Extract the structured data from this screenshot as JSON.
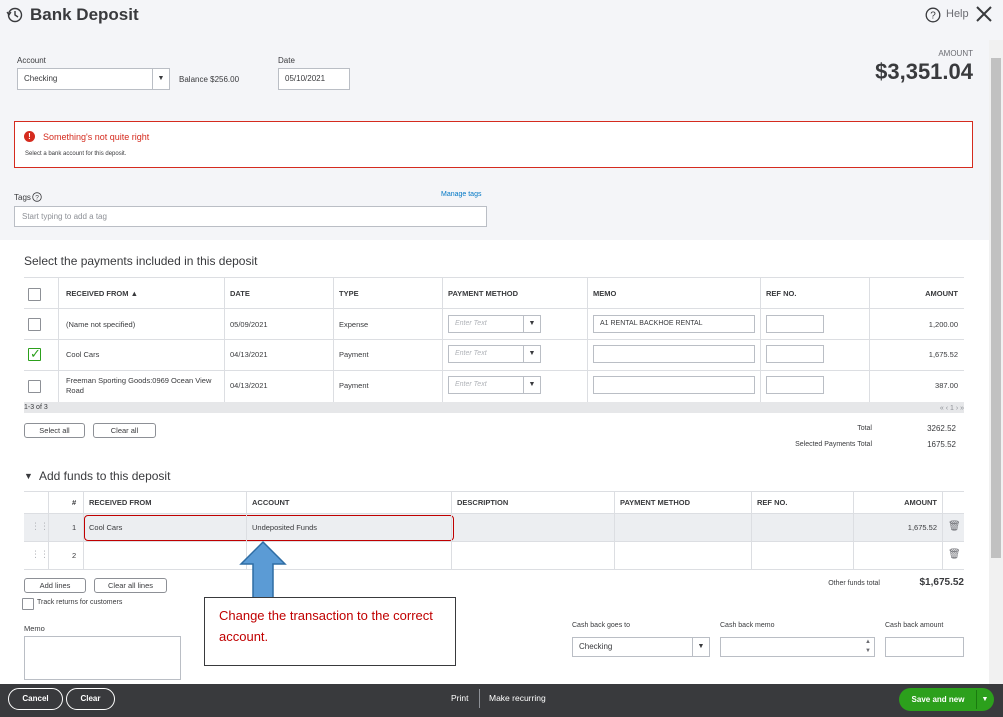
{
  "header": {
    "title": "Bank Deposit",
    "help_label": "Help",
    "account_label": "Account",
    "account_value": "Checking",
    "balance": "Balance $256.00",
    "date_label": "Date",
    "date_value": "05/10/2021",
    "amount_label": "AMOUNT",
    "amount_value": "$3,351.04"
  },
  "error": {
    "title": "Something's not quite right",
    "message": "Select a bank account for this deposit."
  },
  "tags": {
    "label": "Tags",
    "manage": "Manage tags",
    "placeholder": "Start typing to add a tag"
  },
  "payments": {
    "title": "Select the payments included in this deposit",
    "columns": {
      "received_from": "RECEIVED FROM ▲",
      "date": "DATE",
      "type": "TYPE",
      "payment_method": "PAYMENT METHOD",
      "memo": "MEMO",
      "ref_no": "REF NO.",
      "amount": "AMOUNT"
    },
    "rows": [
      {
        "received_from": "(Name not specified)",
        "date": "05/09/2021",
        "type": "Expense",
        "method_placeholder": "Enter Text",
        "memo": "A1 RENTAL BACKHOE RENTAL",
        "ref": "",
        "amount": "1,200.00",
        "checked": false
      },
      {
        "received_from": "Cool Cars",
        "date": "04/13/2021",
        "type": "Payment",
        "method_placeholder": "Enter Text",
        "memo": "",
        "ref": "",
        "amount": "1,675.52",
        "checked": true
      },
      {
        "received_from": "Freeman Sporting Goods:0969 Ocean View Road",
        "date": "04/13/2021",
        "type": "Payment",
        "method_placeholder": "Enter Text",
        "memo": "",
        "ref": "",
        "amount": "387.00",
        "checked": false
      }
    ],
    "range": "1-3 of 3",
    "pager": "« ‹ 1 › »",
    "select_all": "Select all",
    "clear_all": "Clear all",
    "total_label": "Total",
    "total_value": "3262.52",
    "selected_label": "Selected Payments Total",
    "selected_value": "1675.52"
  },
  "funds": {
    "title": "Add funds to this deposit",
    "toggle": "▼",
    "columns": {
      "num": "#",
      "received_from": "RECEIVED FROM",
      "account": "ACCOUNT",
      "description": "DESCRIPTION",
      "payment_method": "PAYMENT METHOD",
      "ref_no": "REF NO.",
      "amount": "AMOUNT"
    },
    "rows": [
      {
        "num": "1",
        "received_from": "Cool Cars",
        "account": "Undeposited Funds",
        "amount": "1,675.52"
      },
      {
        "num": "2",
        "received_from": "",
        "account": "",
        "amount": ""
      }
    ],
    "add_lines": "Add lines",
    "clear_all_lines": "Clear all lines",
    "other_total_label": "Other funds total",
    "other_total_value": "$1,675.52",
    "track_returns": "Track returns for customers"
  },
  "callout": {
    "text": "Change the transaction to the correct account."
  },
  "bottom": {
    "memo_label": "Memo",
    "cash_back_goes_to_label": "Cash back goes to",
    "cash_back_goes_to_value": "Checking",
    "cash_back_memo_label": "Cash back memo",
    "cash_back_amount_label": "Cash back amount"
  },
  "footer": {
    "cancel": "Cancel",
    "clear": "Clear",
    "print": "Print",
    "make_recurring": "Make recurring",
    "save_and_new": "Save and new"
  },
  "colors": {
    "error": "#d52b1e",
    "link": "#0077c5",
    "primary_green": "#2ca01c",
    "footer_bg": "#393a3d",
    "callout_text": "#c00000",
    "arrow_fill": "#5b9bd5"
  }
}
